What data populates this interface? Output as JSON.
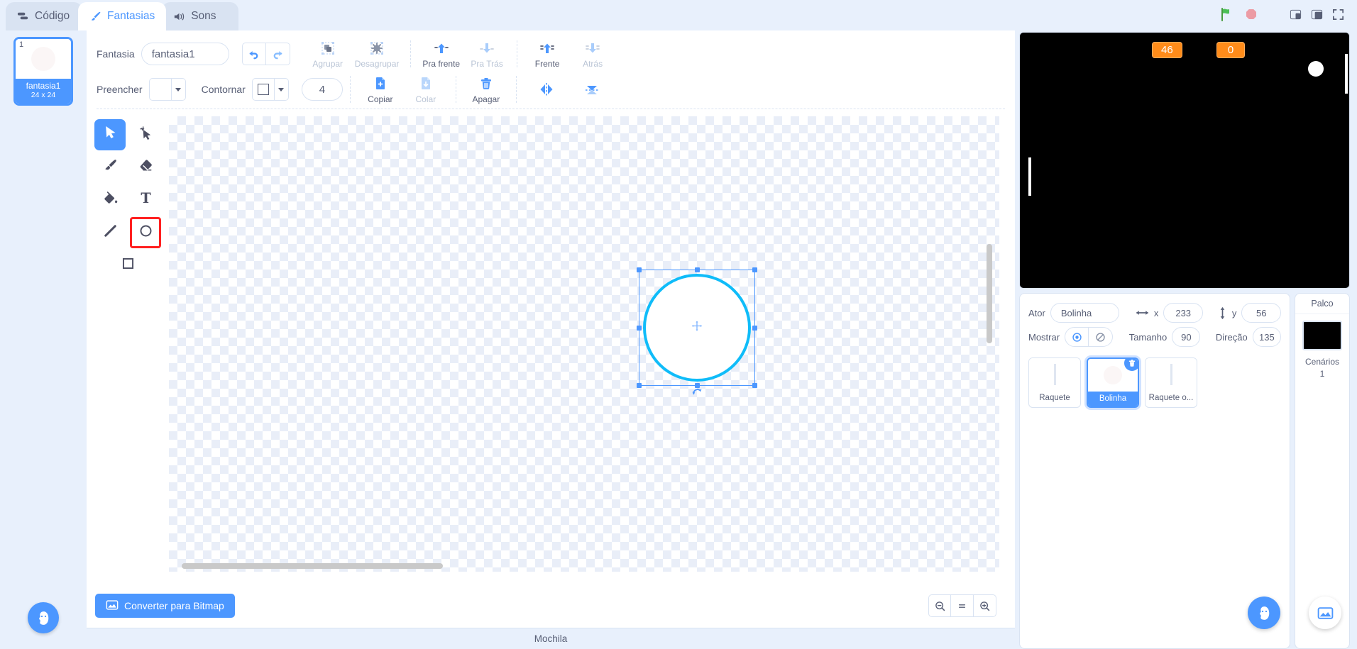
{
  "tabs": [
    {
      "label": "Código",
      "icon": "code-icon",
      "active": false
    },
    {
      "label": "Fantasias",
      "icon": "brush-icon",
      "active": true
    },
    {
      "label": "Sons",
      "icon": "sound-icon",
      "active": false
    }
  ],
  "topright": {
    "green_flag": "green-flag-icon",
    "stop": "stop-icon",
    "small_stage": "small-stage-icon",
    "large_stage": "large-stage-icon",
    "fullscreen": "fullscreen-icon"
  },
  "costume_selector": {
    "items": [
      {
        "number": "1",
        "name": "fantasia1",
        "size": "24 x 24",
        "selected": true
      }
    ],
    "add_button": "add-costume-button"
  },
  "paint": {
    "name_label": "Fantasia",
    "name_value": "fantasia1",
    "undo": "undo-icon",
    "redo": "redo-icon",
    "actions": [
      {
        "label": "Agrupar",
        "icon": "group-icon",
        "disabled": true
      },
      {
        "label": "Desagrupar",
        "icon": "ungroup-icon",
        "disabled": true
      },
      {
        "label": "Pra frente",
        "icon": "forward-icon",
        "disabled": false
      },
      {
        "label": "Pra Trás",
        "icon": "backward-icon",
        "disabled": true
      },
      {
        "label": "Frente",
        "icon": "front-icon",
        "disabled": false
      },
      {
        "label": "Atrás",
        "icon": "back-icon",
        "disabled": true
      }
    ],
    "fill_label": "Preencher",
    "outline_label": "Contornar",
    "stroke_width": "4",
    "actions2": [
      {
        "label": "Copiar",
        "icon": "copy-icon",
        "disabled": false
      },
      {
        "label": "Colar",
        "icon": "paste-icon",
        "disabled": true
      },
      {
        "label": "Apagar",
        "icon": "delete-icon",
        "disabled": false
      }
    ],
    "flip_horizontal": "flip-horizontal-icon",
    "flip_vertical": "flip-vertical-icon",
    "tools": [
      {
        "name": "select-tool",
        "icon": "arrow-cursor-icon",
        "active": true,
        "annotated": false
      },
      {
        "name": "reshape-tool",
        "icon": "reshape-icon",
        "active": false,
        "annotated": false
      },
      {
        "name": "brush-tool",
        "icon": "paintbrush-icon",
        "active": false,
        "annotated": false
      },
      {
        "name": "eraser-tool",
        "icon": "eraser-icon",
        "active": false,
        "annotated": false
      },
      {
        "name": "fill-tool",
        "icon": "paint-bucket-icon",
        "active": false,
        "annotated": false
      },
      {
        "name": "text-tool",
        "icon": "text-icon",
        "active": false,
        "annotated": false
      },
      {
        "name": "line-tool",
        "icon": "line-icon",
        "active": false,
        "annotated": false
      },
      {
        "name": "circle-tool",
        "icon": "circle-icon",
        "active": false,
        "annotated": true
      },
      {
        "name": "rectangle-tool",
        "icon": "square-icon",
        "active": false,
        "annotated": false
      }
    ],
    "convert_label": "Converter para Bitmap",
    "zoom_out": "zoom-out-icon",
    "zoom_reset": "zoom-reset-icon",
    "zoom_in": "zoom-in-icon"
  },
  "stage": {
    "monitors": [
      {
        "value": "46"
      },
      {
        "value": "0"
      }
    ]
  },
  "sprite_info": {
    "actor_label": "Ator",
    "actor_name": "Bolinha",
    "x_label": "x",
    "x_value": "233",
    "y_label": "y",
    "y_value": "56",
    "show_label": "Mostrar",
    "size_label": "Tamanho",
    "size_value": "90",
    "direction_label": "Direção",
    "direction_value": "135"
  },
  "sprites": [
    {
      "name": "Raquete",
      "selected": false,
      "thumb": "paddle"
    },
    {
      "name": "Bolinha",
      "selected": true,
      "thumb": "ball"
    },
    {
      "name": "Raquete o...",
      "selected": false,
      "thumb": "paddle"
    }
  ],
  "stage_panel": {
    "title": "Palco",
    "backdrops_label": "Cenários",
    "backdrops_count": "1"
  },
  "backpack": {
    "label": "Mochila"
  },
  "colors": {
    "accent": "#4c97ff",
    "panel_bg": "#e8f0fc",
    "text": "#575e75",
    "disabled_text": "#b9c4d5",
    "monitor_orange": "#ff8c1a",
    "annotation_red": "#ff2020",
    "shape_stroke": "#0fbcf9"
  }
}
